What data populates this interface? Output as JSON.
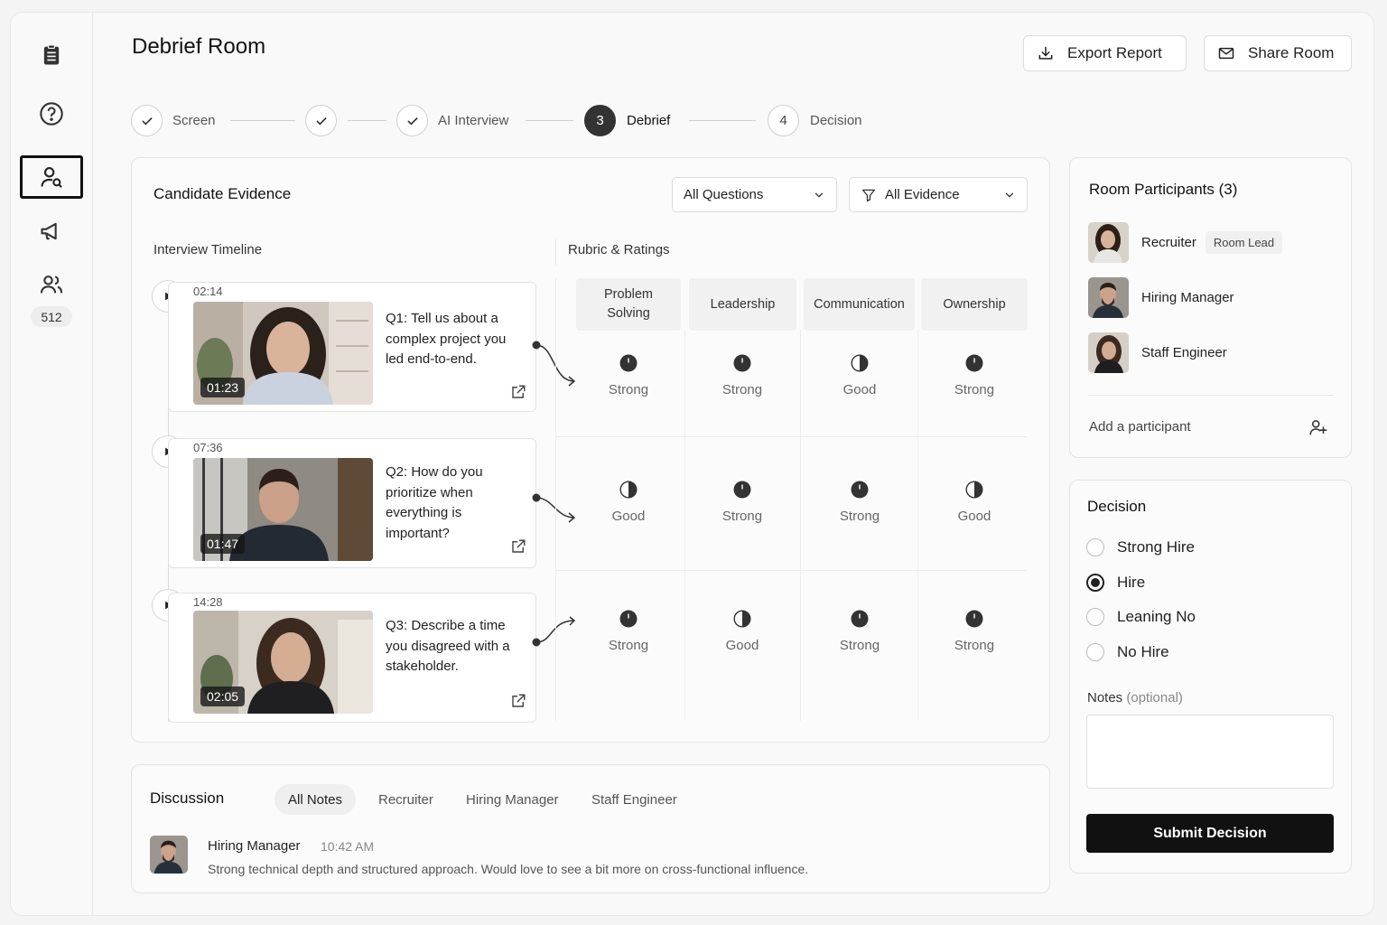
{
  "page": {
    "title": "Debrief Room"
  },
  "header": {
    "export_label": "Export Report",
    "share_label": "Share Room"
  },
  "sidebar": {
    "items": [
      {
        "icon": "clipboard-icon"
      },
      {
        "icon": "help-icon"
      },
      {
        "icon": "user-search-icon",
        "active": true
      },
      {
        "icon": "megaphone-icon"
      },
      {
        "icon": "users-icon",
        "badge": "512"
      }
    ]
  },
  "stepper": {
    "steps": [
      {
        "label": "Screen",
        "state": "done"
      },
      {
        "label": "",
        "state": "done"
      },
      {
        "label": "AI Interview",
        "state": "done"
      },
      {
        "label": "Debrief",
        "number": "3",
        "state": "current"
      },
      {
        "label": "Decision",
        "number": "4",
        "state": "upcoming"
      }
    ]
  },
  "evidence": {
    "title": "Candidate Evidence",
    "filter_questions": "All Questions",
    "filter_evidence": "All Evidence",
    "timeline_title": "Interview Timeline",
    "rubric_title": "Rubric & Ratings",
    "rubric_columns": [
      "Problem\nSolving",
      "Leadership",
      "Communication",
      "Ownership"
    ],
    "questions": [
      {
        "timestamp": "02:14",
        "duration": "01:23",
        "text": "Q1: Tell us about a complex project you led end-to-end.",
        "ratings": [
          "Strong",
          "Strong",
          "Good",
          "Strong"
        ]
      },
      {
        "timestamp": "07:36",
        "duration": "01:47",
        "text": "Q2: How do you prioritize when everything is important?",
        "ratings": [
          "Good",
          "Strong",
          "Strong",
          "Good"
        ]
      },
      {
        "timestamp": "14:28",
        "duration": "02:05",
        "text": "Q3: Describe a time you disagreed with a stakeholder.",
        "ratings": [
          "Strong",
          "Good",
          "Strong",
          "Strong"
        ]
      }
    ]
  },
  "participants": {
    "title": "Room Participants (3)",
    "list": [
      {
        "name": "Recruiter",
        "tag": "Room Lead"
      },
      {
        "name": "Hiring Manager",
        "tag": ""
      },
      {
        "name": "Staff Engineer",
        "tag": ""
      }
    ],
    "add_label": "Add a participant"
  },
  "decision": {
    "title": "Decision",
    "options": [
      {
        "label": "Strong Hire",
        "selected": false
      },
      {
        "label": "Hire",
        "selected": true
      },
      {
        "label": "Leaning No",
        "selected": false
      },
      {
        "label": "No Hire",
        "selected": false
      }
    ],
    "notes_label": "Notes",
    "notes_optional": "(optional)",
    "notes_value": "",
    "submit_label": "Submit Decision"
  },
  "discussion": {
    "title": "Discussion",
    "tabs": [
      {
        "label": "All Notes",
        "active": true
      },
      {
        "label": "Recruiter",
        "active": false
      },
      {
        "label": "Hiring Manager",
        "active": false
      },
      {
        "label": "Staff Engineer",
        "active": false
      }
    ],
    "note": {
      "author": "Hiring Manager",
      "time": "10:42 AM",
      "text": "Strong technical depth and structured approach. Would love to see a bit more on cross-functional influence."
    }
  },
  "colors": {
    "primary": "#111111",
    "accent_dark": "#333333",
    "border": "#e4e4e4"
  }
}
